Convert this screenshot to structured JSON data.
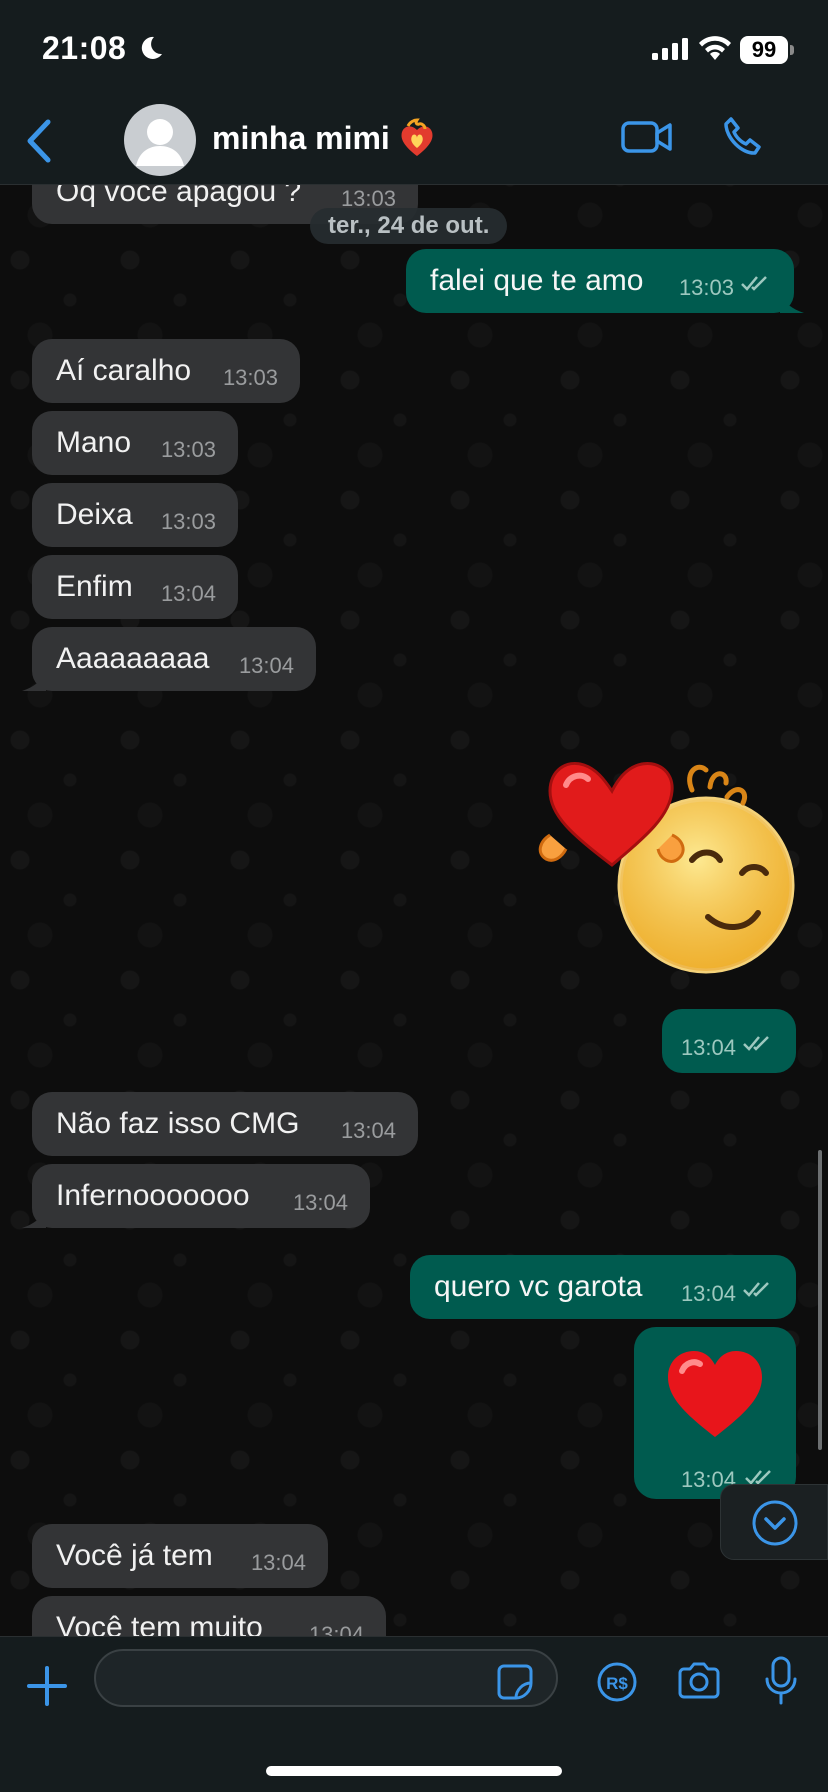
{
  "status_bar": {
    "time": "21:08",
    "battery": "99",
    "icons": [
      "moon-icon",
      "signal-icon",
      "wifi-icon",
      "battery-icon"
    ]
  },
  "header": {
    "contact_name": "minha mimi",
    "back_icon": "chevron-left-icon",
    "name_emoji": "heart-on-fire-icon",
    "actions": [
      "video-call-icon",
      "voice-call-icon"
    ]
  },
  "date_chip": "ter., 24 de out.",
  "messages": [
    {
      "direction": "in",
      "text": "Oq voce apagou ?",
      "time": "13:03"
    },
    {
      "direction": "out",
      "text": "falei que te amo",
      "time": "13:03",
      "read": true
    },
    {
      "direction": "in",
      "text": "Aí caralho",
      "time": "13:03"
    },
    {
      "direction": "in",
      "text": "Mano",
      "time": "13:03"
    },
    {
      "direction": "in",
      "text": "Deixa",
      "time": "13:03"
    },
    {
      "direction": "in",
      "text": "Enfim",
      "time": "13:04"
    },
    {
      "direction": "in",
      "text": "Aaaaaaaaa",
      "time": "13:04"
    },
    {
      "direction": "out",
      "type": "sticker",
      "description_icon": "smiling-face-heart-sticker",
      "time": "13:04",
      "read": true
    },
    {
      "direction": "in",
      "text": "Não faz isso CMG",
      "time": "13:04"
    },
    {
      "direction": "in",
      "text": "Infernooooooo",
      "time": "13:04"
    },
    {
      "direction": "out",
      "text": "quero vc garota",
      "time": "13:04",
      "read": true
    },
    {
      "direction": "out",
      "type": "emoji",
      "description_icon": "red-heart-emoji",
      "time": "13:04",
      "read": true
    },
    {
      "direction": "in",
      "text": "Você já tem",
      "time": "13:04"
    },
    {
      "direction": "in",
      "text": "Você tem muito",
      "time": "13:04"
    }
  ],
  "input_bar": {
    "placeholder": "",
    "icons": [
      "plus-icon",
      "sticker-icon",
      "pix-icon",
      "camera-icon",
      "microphone-icon"
    ]
  },
  "colors": {
    "outgoing_bubble": "#005b4f",
    "incoming_bubble": "#333436",
    "accent_blue": "#3b95e8",
    "header_bg": "#151c1e"
  }
}
